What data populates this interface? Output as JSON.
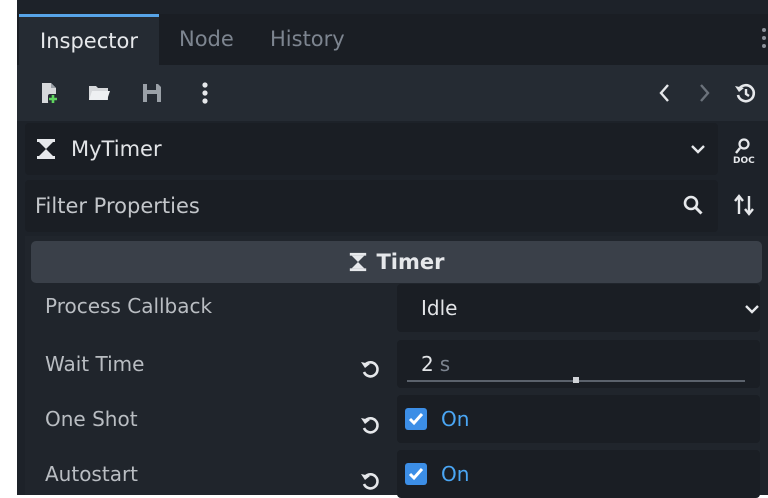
{
  "tabs": [
    {
      "label": "Inspector",
      "active": true
    },
    {
      "label": "Node",
      "active": false
    },
    {
      "label": "History",
      "active": false
    }
  ],
  "toolbar": {
    "icons": [
      "new-resource-icon",
      "open-folder-icon",
      "save-icon",
      "more-icon",
      "back-icon",
      "forward-icon",
      "history-icon"
    ]
  },
  "object": {
    "name": "MyTimer",
    "icon": "hourglass-icon"
  },
  "filter": {
    "placeholder": "Filter Properties"
  },
  "section": {
    "title": "Timer"
  },
  "properties": {
    "process_callback": {
      "label": "Process Callback",
      "value": "Idle"
    },
    "wait_time": {
      "label": "Wait Time",
      "value": "2",
      "unit": "s",
      "slider_fraction": 0.5
    },
    "one_shot": {
      "label": "One Shot",
      "value": "On",
      "checked": true
    },
    "autostart": {
      "label": "Autostart",
      "value": "On",
      "checked": true
    }
  },
  "colors": {
    "accent": "#57a4e8",
    "check": "#3c8ee6",
    "panel": "#1d2229"
  }
}
